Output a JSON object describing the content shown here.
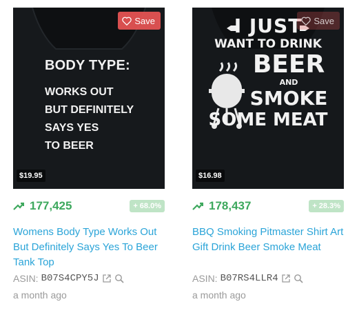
{
  "products": [
    {
      "save_label": "Save",
      "price": "$19.95",
      "design": {
        "title": "BODY TYPE:",
        "lines": [
          "WORKS OUT",
          "BUT DEFINITELY",
          "SAYS YES",
          "TO BEER"
        ]
      },
      "rank": "177,425",
      "change": "+ 68.0%",
      "title": "Womens Body Type Works Out But Definitely Says Yes To Beer Tank Top",
      "asin_label": "ASIN:",
      "asin": "B07S4CPY5J",
      "date": "a month ago"
    },
    {
      "save_label": "Save",
      "price": "$16.98",
      "design": {
        "lines": [
          "I JUST",
          "WANT TO DRINK",
          "BEER",
          "AND",
          "SMOKE",
          "SOME MEAT"
        ]
      },
      "rank": "178,437",
      "change": "+ 28.3%",
      "title": "BBQ Smoking Pitmaster Shirt Art Gift Drink Beer Smoke Meat",
      "asin_label": "ASIN:",
      "asin": "B07RS4LLR4",
      "date": "a month ago"
    }
  ],
  "colors": {
    "accent_link": "#2aa4d8",
    "rank_green": "#3da85d",
    "badge_bg": "#bfe4c6",
    "save_red": "#e95555"
  }
}
